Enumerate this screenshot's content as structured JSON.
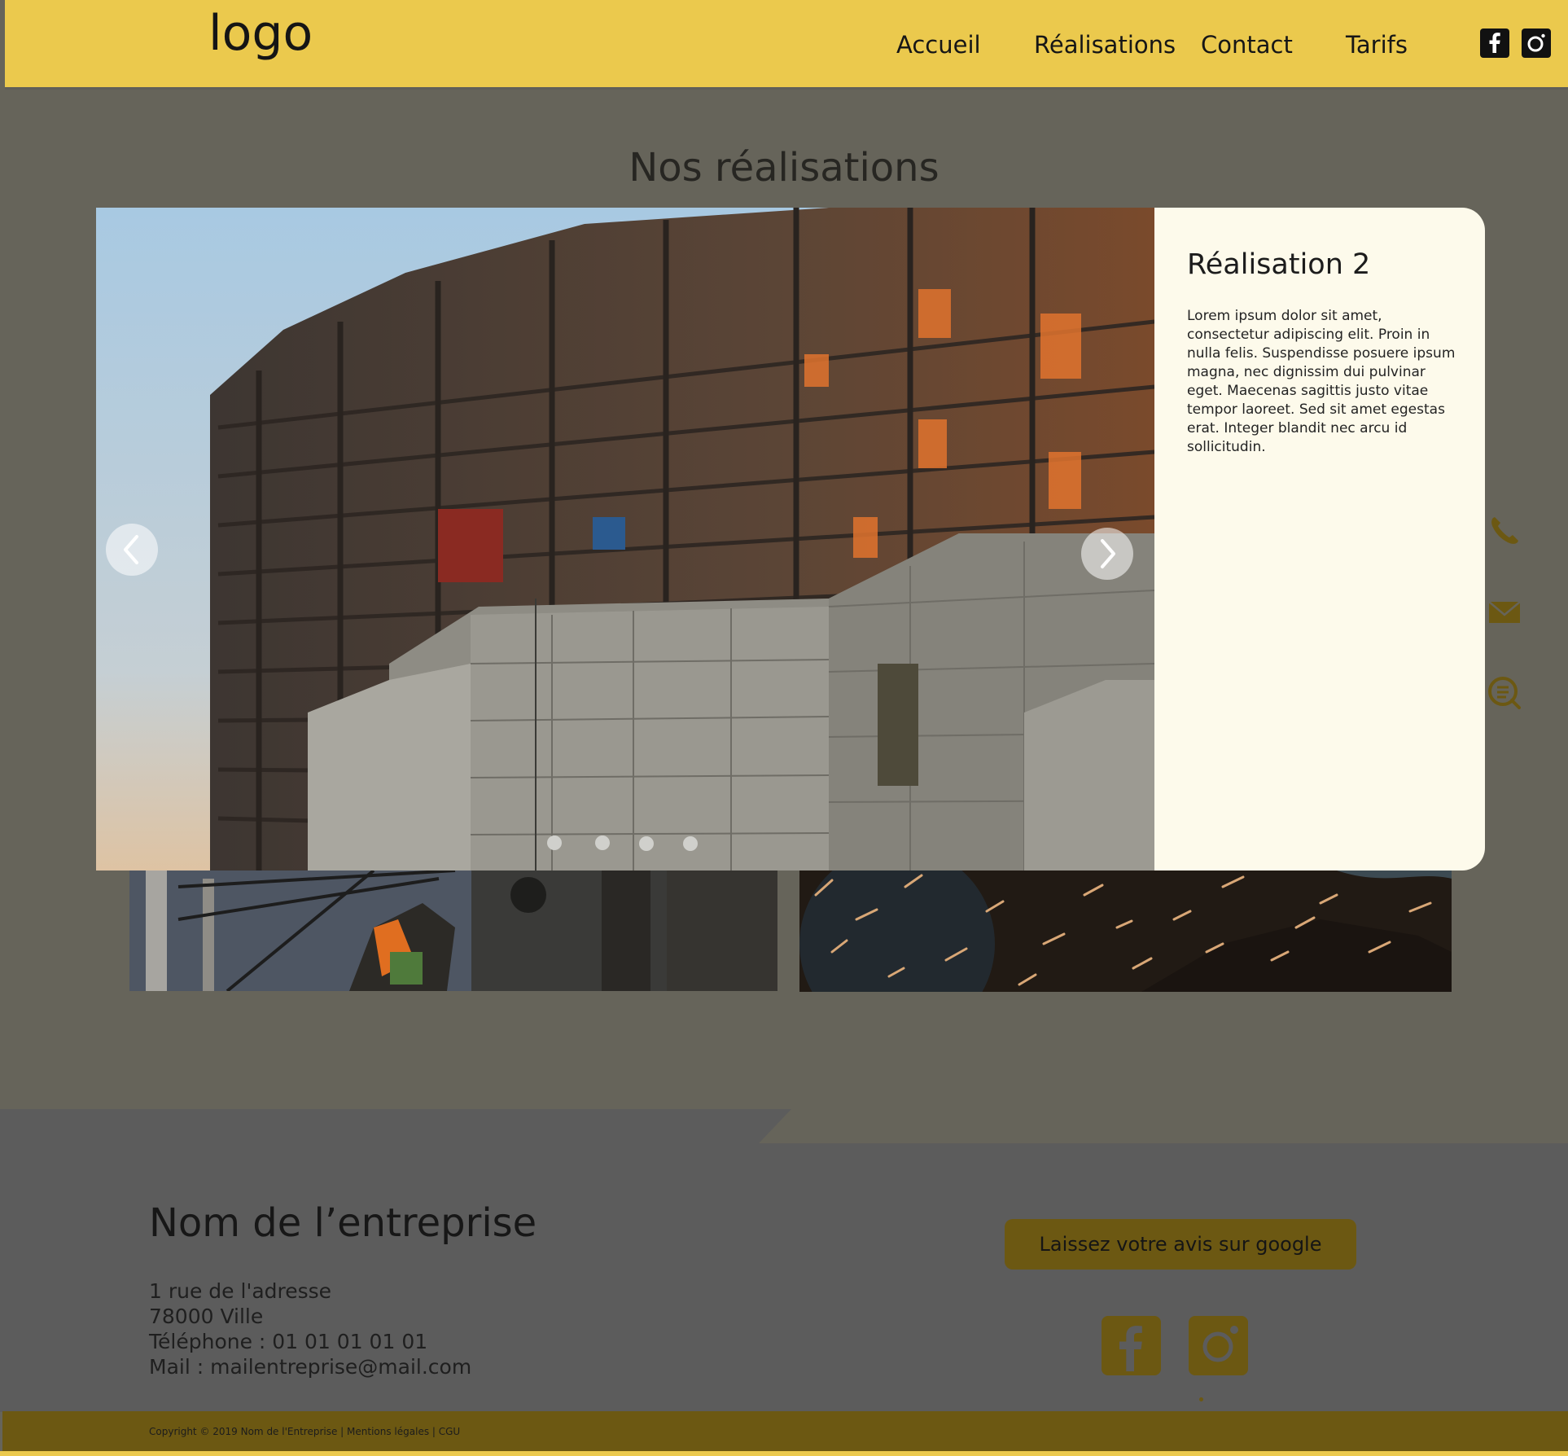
{
  "header": {
    "logo": "logo",
    "nav": [
      "Accueil",
      "Réalisations",
      "Contact",
      "Tarifs"
    ],
    "social_icons": [
      "facebook-icon",
      "instagram-icon"
    ]
  },
  "main": {
    "title": "Nos réalisations",
    "slider": {
      "slide_title": "Réalisation 2",
      "slide_text": "Lorem ipsum dolor sit amet, consectetur adipiscing elit. Proin in nulla felis. Suspendisse posuere ipsum magna, nec dignissim dui pulvinar eget. Maecenas sagittis justo vitae tempor laoreet. Sed sit amet egestas erat. Integer blandit nec arcu id sollicitudin.",
      "dots_count": 4,
      "prev_icon": "chevron-left-icon",
      "next_icon": "chevron-right-icon"
    },
    "side_icons": [
      "phone-icon",
      "mail-icon",
      "chat-icon"
    ]
  },
  "footer": {
    "company": "Nom de l’entreprise",
    "address_line1": "1 rue de l'adresse",
    "address_line2": "78000 Ville",
    "phone": "Téléphone : 01 01 01 01 01",
    "mail": "Mail : mailentreprise@mail.com",
    "review_button": "Laissez votre avis sur google",
    "copyright": "Copyright © 2019 Nom de l'Entreprise | Mentions légales | CGU"
  },
  "colors": {
    "header_bg": "#ebc94d",
    "page_bg": "#66645a",
    "footer_bg": "#5c5c5c",
    "accent_dark": "#6c5812",
    "panel_bg": "#fdfaeb"
  }
}
